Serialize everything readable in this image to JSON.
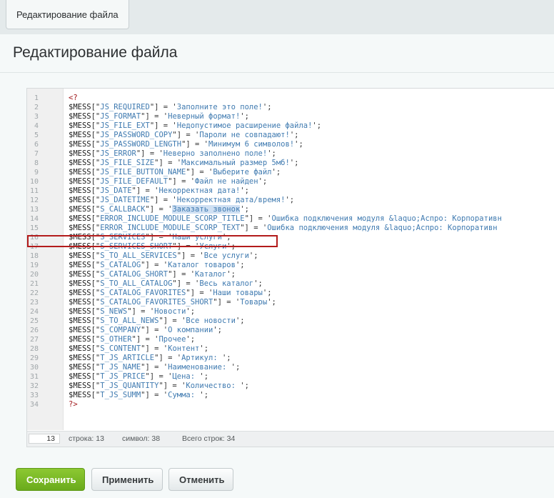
{
  "tab": {
    "label": "Редактирование файла"
  },
  "page": {
    "title": "Редактирование файла"
  },
  "editor": {
    "open_tag": "<?",
    "close_tag": "?>",
    "lines": [
      {
        "n": "1",
        "type": "open"
      },
      {
        "n": "2",
        "key": "JS_REQUIRED",
        "value": "Заполните это поле!"
      },
      {
        "n": "3",
        "key": "JS_FORMAT",
        "value": "Неверный формат!"
      },
      {
        "n": "4",
        "key": "JS_FILE_EXT",
        "value": "Недопустимое расширение файла!"
      },
      {
        "n": "5",
        "key": "JS_PASSWORD_COPY",
        "value": "Пароли не совпадают!"
      },
      {
        "n": "6",
        "key": "JS_PASSWORD_LENGTH",
        "value": "Минимум 6 символов!"
      },
      {
        "n": "7",
        "key": "JS_ERROR",
        "value": "Неверно заполнено поле!"
      },
      {
        "n": "8",
        "key": "JS_FILE_SIZE",
        "value": "Максимальный размер 5мб!"
      },
      {
        "n": "9",
        "key": "JS_FILE_BUTTON_NAME",
        "value": "Выберите файл"
      },
      {
        "n": "10",
        "key": "JS_FILE_DEFAULT",
        "value": "Файл не найден"
      },
      {
        "n": "11",
        "key": "JS_DATE",
        "value": "Некорректная дата!"
      },
      {
        "n": "12",
        "key": "JS_DATETIME",
        "value": "Некорректная дата/время!"
      },
      {
        "n": "13",
        "key": "S_CALLBACK",
        "value": "Заказать звонок",
        "selected": true
      },
      {
        "n": "14",
        "key": "ERROR_INCLUDE_MODULE_SCORP_TITLE",
        "value": "Ошибка подключения модуля &laquo;Аспро: Корпоративн"
      },
      {
        "n": "15",
        "key": "ERROR_INCLUDE_MODULE_SCORP_TEXT",
        "value": "Ошибка подключения модуля &laquo;Аспро: Корпоративн"
      },
      {
        "n": "16",
        "key": "S_SERVICES",
        "value": "Наши услуги"
      },
      {
        "n": "17",
        "key": "S_SERVICES_SHORT",
        "value": "Услуги"
      },
      {
        "n": "18",
        "key": "S_TO_ALL_SERVICES",
        "value": "Все услуги"
      },
      {
        "n": "19",
        "key": "S_CATALOG",
        "value": "Каталог товаров"
      },
      {
        "n": "20",
        "key": "S_CATALOG_SHORT",
        "value": "Каталог"
      },
      {
        "n": "21",
        "key": "S_TO_ALL_CATALOG",
        "value": "Весь каталог"
      },
      {
        "n": "22",
        "key": "S_CATALOG_FAVORITES",
        "value": "Наши товары"
      },
      {
        "n": "23",
        "key": "S_CATALOG_FAVORITES_SHORT",
        "value": "Товары"
      },
      {
        "n": "24",
        "key": "S_NEWS",
        "value": "Новости"
      },
      {
        "n": "25",
        "key": "S_TO_ALL_NEWS",
        "value": "Все новости"
      },
      {
        "n": "26",
        "key": "S_COMPANY",
        "value": "О компании"
      },
      {
        "n": "27",
        "key": "S_OTHER",
        "value": "Прочее"
      },
      {
        "n": "28",
        "key": "S_CONTENT",
        "value": "Контент"
      },
      {
        "n": "29",
        "key": "T_JS_ARTICLE",
        "value": "Артикул: "
      },
      {
        "n": "30",
        "key": "T_JS_NAME",
        "value": "Наименование: "
      },
      {
        "n": "31",
        "key": "T_JS_PRICE",
        "value": "Цена: "
      },
      {
        "n": "32",
        "key": "T_JS_QUANTITY",
        "value": "Количество: "
      },
      {
        "n": "33",
        "key": "T_JS_SUMM",
        "value": "Сумма: "
      },
      {
        "n": "34",
        "type": "close"
      }
    ]
  },
  "status": {
    "current_line": "13",
    "line": "строка: 13",
    "symbol": "символ: 38",
    "total": "Всего строк: 34"
  },
  "buttons": {
    "save": "Сохранить",
    "apply": "Применить",
    "cancel": "Отменить"
  }
}
